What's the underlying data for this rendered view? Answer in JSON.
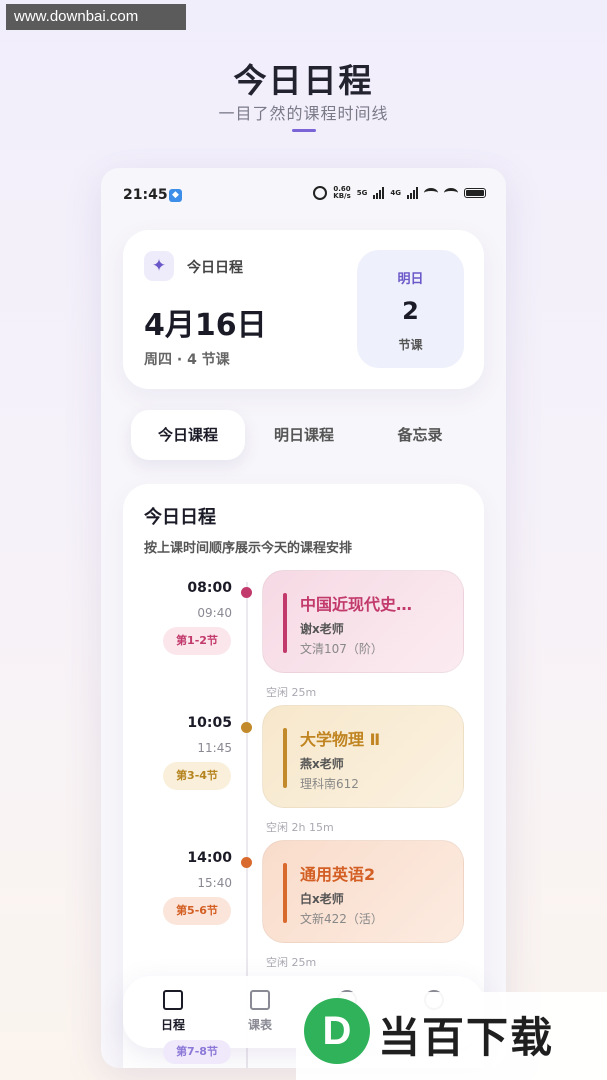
{
  "watermark_top": "www.downbai.com",
  "hero": {
    "title": "今日日程",
    "subtitle": "一目了然的课程时间线"
  },
  "statusbar": {
    "time": "21:45",
    "speed": "0.60\nKB/s",
    "net1": "5G",
    "net2": "4G"
  },
  "summary": {
    "label": "今日日程",
    "date": "4月16日",
    "meta": "周四 · 4 节课",
    "tomorrow": {
      "label": "明日",
      "count": "2",
      "unit": "节课"
    }
  },
  "tabs": [
    {
      "label": "今日课程",
      "active": true
    },
    {
      "label": "明日课程",
      "active": false
    },
    {
      "label": "备忘录",
      "active": false
    }
  ],
  "schedule": {
    "title": "今日日程",
    "description": "按上课时间顺序展示今天的课程安排",
    "items": [
      {
        "start": "08:00",
        "end": "09:40",
        "period": "第1-2节",
        "course": "中国近现代史…",
        "teacher": "谢x老师",
        "room": "文清107（阶）",
        "gap": "空闲 25m",
        "accent": "#c23a6b"
      },
      {
        "start": "10:05",
        "end": "11:45",
        "period": "第3-4节",
        "course": "大学物理 Ⅱ",
        "teacher": "燕x老师",
        "room": "理科南612",
        "gap": "空闲 2h 15m",
        "accent": "#c28a2a"
      },
      {
        "start": "14:00",
        "end": "15:40",
        "period": "第5-6节",
        "course": "通用英语2",
        "teacher": "白x老师",
        "room": "文新422（活）",
        "gap": "空闲 25m",
        "accent": "#d96a2e"
      }
    ],
    "peek_period": "第7-8节"
  },
  "nav": [
    {
      "label": "日程",
      "icon": "calendar-icon",
      "active": true
    },
    {
      "label": "课表",
      "icon": "book-icon",
      "active": false
    },
    {
      "label": "",
      "icon": "group-icon",
      "active": false
    },
    {
      "label": "",
      "icon": "user-icon",
      "active": false
    }
  ],
  "logo_watermark": {
    "letter": "D",
    "text": "当百下载",
    "color": "#2fb25a"
  }
}
